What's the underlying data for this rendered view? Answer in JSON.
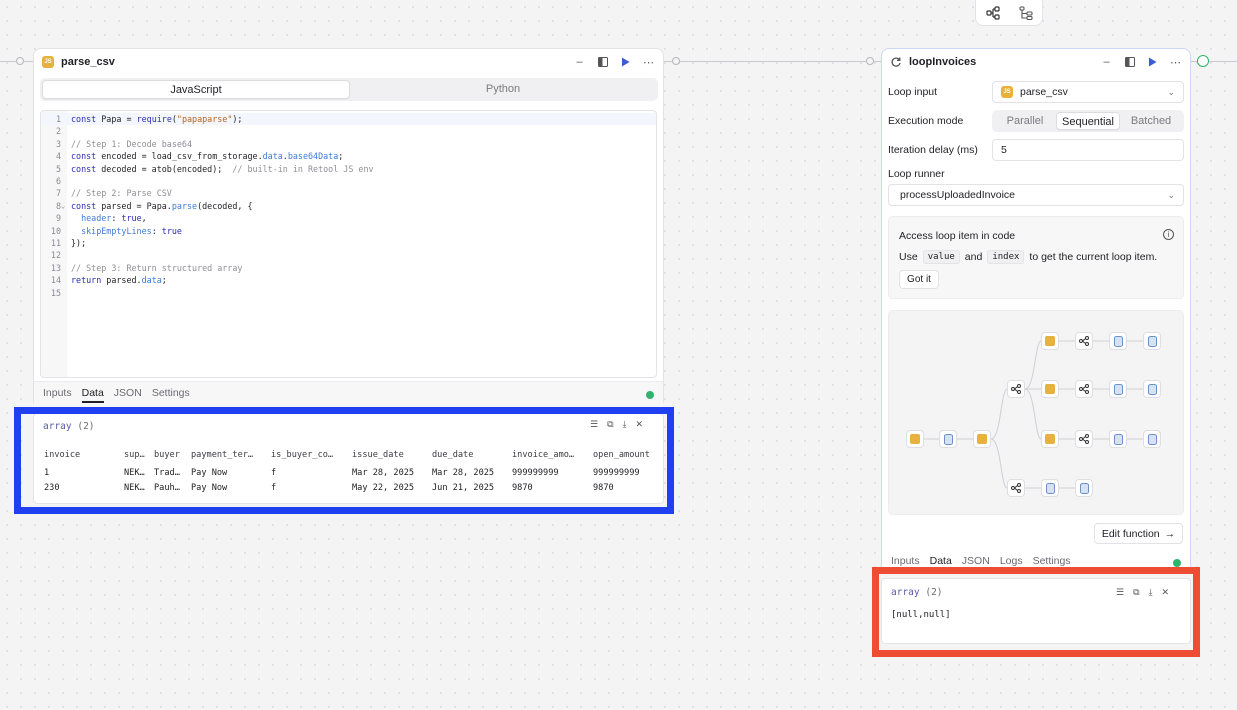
{
  "toolbar": {
    "icons": [
      "workflow-icon",
      "tree-icon"
    ]
  },
  "parse_csv": {
    "title": "parse_csv",
    "badge": "JS",
    "actions": [
      "minimize-icon",
      "split-icon",
      "run-icon",
      "more-icon"
    ],
    "languages": [
      "JavaScript",
      "Python"
    ],
    "active_language": "JavaScript",
    "code_lines": [
      "const Papa = require(\"papaparse\");",
      "",
      "// Step 1: Decode base64",
      "const encoded = load_csv_from_storage.data.base64Data;",
      "const decoded = atob(encoded);  // built-in in Retool JS env",
      "",
      "// Step 2: Parse CSV",
      "const parsed = Papa.parse(decoded, {",
      "  header: true,",
      "  skipEmptyLines: true",
      "});",
      "",
      "// Step 3: Return structured array",
      "return parsed.data;",
      ""
    ],
    "tabs": [
      "Inputs",
      "Data",
      "JSON",
      "Settings"
    ],
    "active_tab": "Data",
    "result": {
      "type_label": "array",
      "count": "(2)",
      "columns": [
        "invoice",
        "sup…",
        "buyer",
        "payment_ter…",
        "is_buyer_co…",
        "issue_date",
        "due_date",
        "invoice_amo…",
        "open_amount"
      ],
      "rows": [
        [
          "1",
          "NEK…",
          "Trad…",
          "Pay Now",
          "f",
          "Mar 28, 2025",
          "Mar 28, 2025",
          "999999999",
          "999999999"
        ],
        [
          "230",
          "NEK…",
          "Pauh…",
          "Pay Now",
          "f",
          "May 22, 2025",
          "Jun 21, 2025",
          "9870",
          "9870"
        ]
      ]
    }
  },
  "loopInvoices": {
    "title": "loopInvoices",
    "loop_input_label": "Loop input",
    "loop_input_value": "parse_csv",
    "execution_mode_label": "Execution mode",
    "execution_modes": [
      "Parallel",
      "Sequential",
      "Batched"
    ],
    "active_mode": "Sequential",
    "iteration_delay_label": "Iteration delay (ms)",
    "iteration_delay_value": "5",
    "loop_runner_label": "Loop runner",
    "loop_runner_value": "processUploadedInvoice",
    "info": {
      "title": "Access loop item in code",
      "text_use": "Use",
      "chip_value": "value",
      "text_and": "and",
      "chip_index": "index",
      "text_rest": "to get the current loop item.",
      "button": "Got it"
    },
    "edit_function": "Edit function",
    "tabs": [
      "Inputs",
      "Data",
      "JSON",
      "Logs",
      "Settings"
    ],
    "active_tab": "Data",
    "result": {
      "type_label": "array",
      "count": "(2)",
      "value": "[null,null]"
    }
  },
  "colors": {
    "highlight_blue": "#1f3ff0",
    "highlight_red": "#ef4d33",
    "status_green": "#30b36b",
    "js_badge": "#e8b13d",
    "accent_purple": "#a06ae0"
  }
}
